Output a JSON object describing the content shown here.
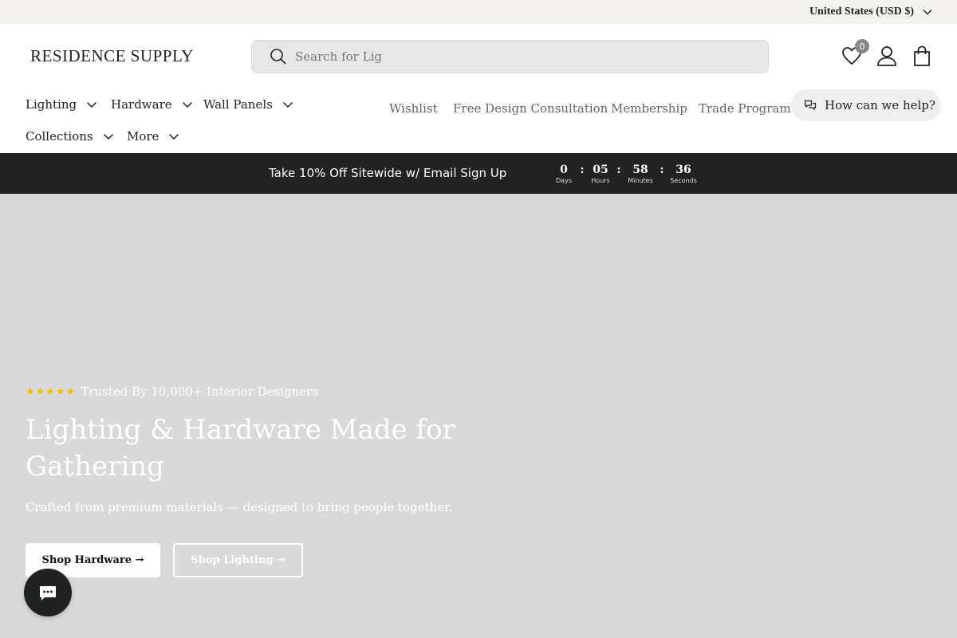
{
  "topbar": {
    "country": "United States (USD $)"
  },
  "header": {
    "logo": "RESIDENCE SUPPLY",
    "search_placeholder": "Search for Lig",
    "wishlist_count": "0"
  },
  "nav": {
    "items": [
      {
        "label": "Lighting"
      },
      {
        "label": "Hardware"
      },
      {
        "label": "Wall Panels"
      },
      {
        "label": "Collections"
      },
      {
        "label": "More"
      }
    ],
    "links": [
      {
        "label": "Wishlist"
      },
      {
        "label": "Free Design Consultation"
      },
      {
        "label": "Membership"
      },
      {
        "label": "Trade Program"
      }
    ],
    "help": "How can we help?"
  },
  "promo": {
    "text": "Take 10% Off Sitewide w/ Email Sign Up",
    "timer": {
      "days": "0",
      "days_label": "Days",
      "hours": "05",
      "hours_label": "Hours",
      "minutes": "58",
      "minutes_label": "Minutes",
      "seconds": "36",
      "seconds_label": "Seconds",
      "separator": ":"
    }
  },
  "hero": {
    "stars": "★★★★★",
    "trust": "Trusted By 10,000+ Interior Designers",
    "title": "Lighting & Hardware Made for Gathering",
    "subtitle": "Crafted from premium materials — designed to bring people together.",
    "primary_button": "Shop Hardware →",
    "secondary_button": "Shop Lighting →"
  },
  "colors": {
    "promo_bg": "#222222",
    "hero_bg": "#d9d9d9",
    "star": "#f2c200"
  }
}
